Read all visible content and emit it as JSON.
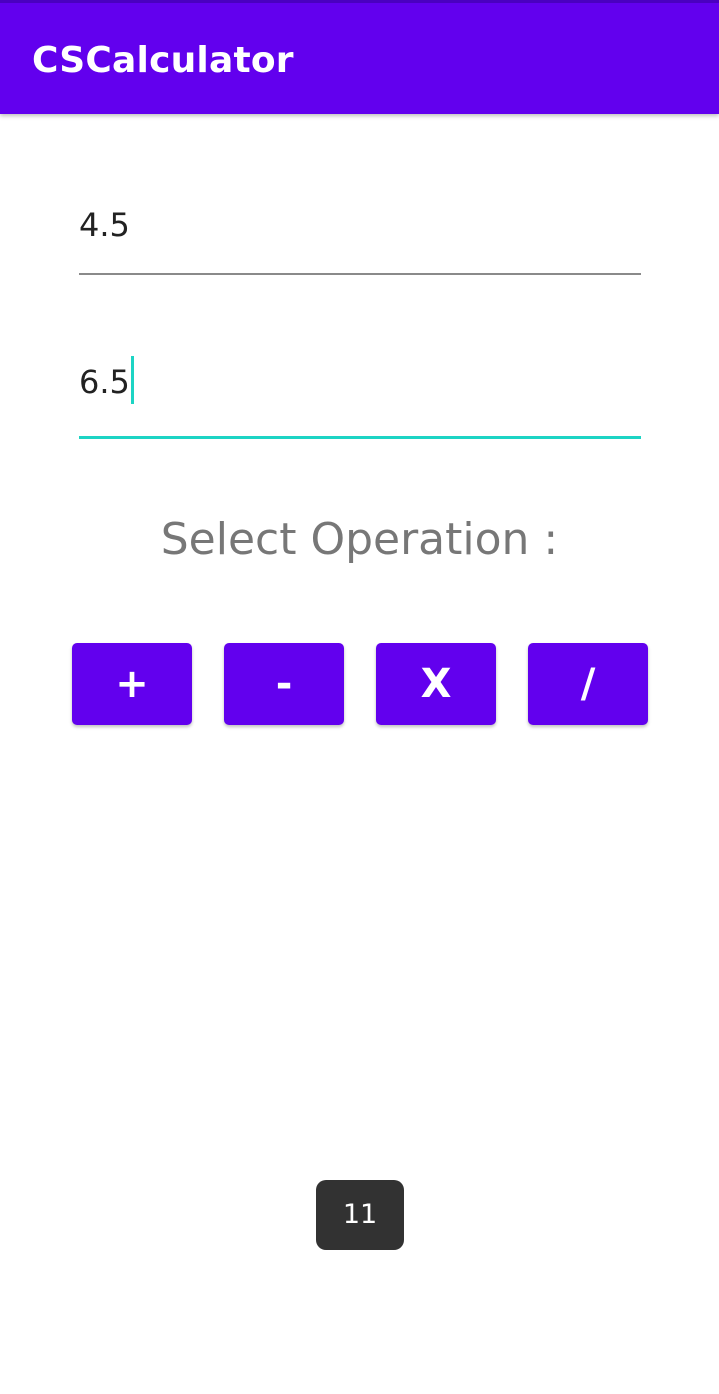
{
  "app_bar": {
    "title": "CSCalculator",
    "color": "#6200EE"
  },
  "inputs": {
    "first_number": {
      "value": "4.5"
    },
    "second_number": {
      "value": "6.5",
      "focused": true
    }
  },
  "select_label": "Select Operation :",
  "operations": {
    "add": "+",
    "subtract": "-",
    "multiply": "X",
    "divide": "/"
  },
  "toast": {
    "text": "11"
  },
  "colors": {
    "accent": "#1cd4c4",
    "button": "#6200EE",
    "toast_bg": "#323232"
  }
}
